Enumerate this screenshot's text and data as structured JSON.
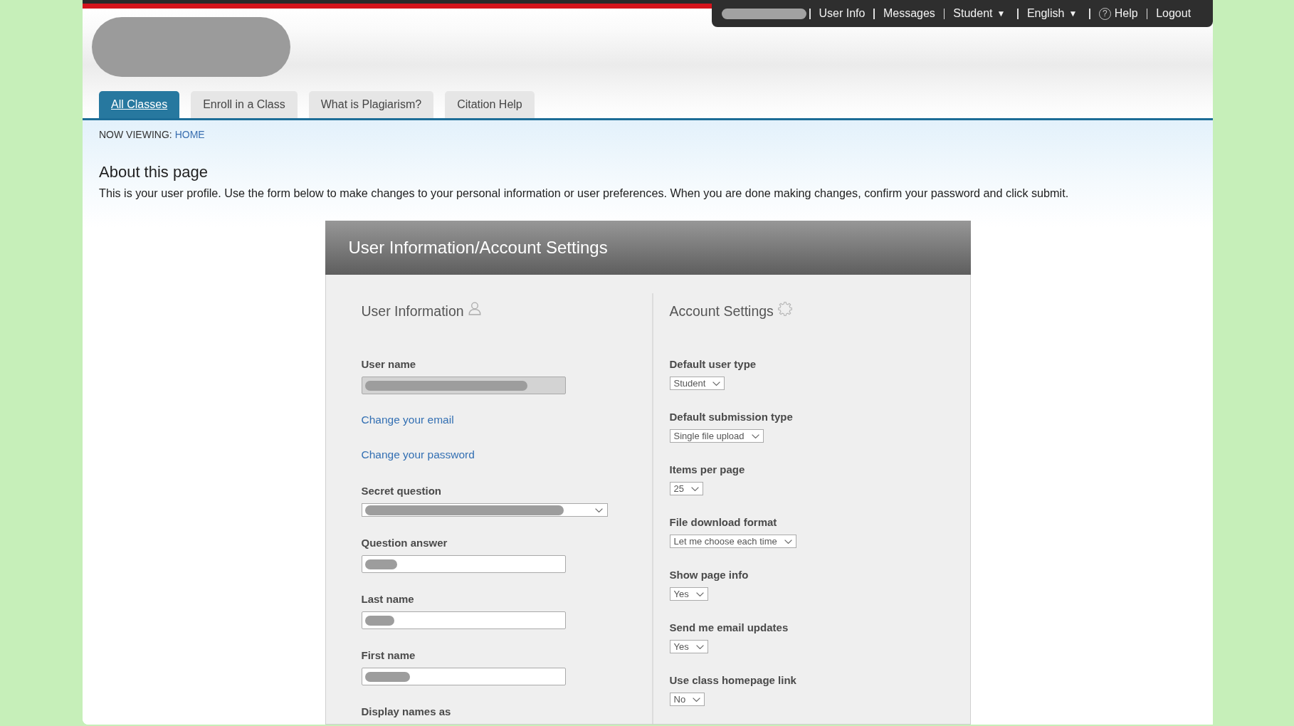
{
  "top_bar": {
    "items": [
      {
        "kind": "link",
        "label": "User Info"
      },
      {
        "kind": "link",
        "label": "Messages"
      },
      {
        "kind": "menu",
        "label": "Student",
        "caret": "▼"
      },
      {
        "kind": "menu",
        "label": "English",
        "caret": "▼"
      },
      {
        "kind": "help",
        "icon": "?",
        "label": "Help"
      },
      {
        "kind": "link",
        "label": "Logout"
      }
    ]
  },
  "tabs": [
    {
      "label": "All Classes",
      "selected": true
    },
    {
      "label": "Enroll in a Class",
      "selected": false
    },
    {
      "label": "What is Plagiarism?",
      "selected": false
    },
    {
      "label": "Citation Help",
      "selected": false
    }
  ],
  "breadcrumb": {
    "label": "NOW VIEWING:",
    "current": "HOME"
  },
  "about": {
    "title": "About this page",
    "text": "This is your user profile. Use the form below to make changes to your personal information or user preferences. When you are done making changes, confirm your password and click submit."
  },
  "settings_card": {
    "title": "User Information/Account Settings",
    "user_information": {
      "heading": "User Information",
      "fields": [
        {
          "kind": "input",
          "label": "User name",
          "disabled": true,
          "redacted": true
        },
        {
          "kind": "link",
          "label": "Change your email"
        },
        {
          "kind": "link",
          "label": "Change your password"
        },
        {
          "kind": "select",
          "label": "Secret question",
          "disabled": false,
          "redacted": true
        },
        {
          "kind": "input",
          "label": "Question answer",
          "disabled": false,
          "redacted": true
        },
        {
          "kind": "input",
          "label": "Last name",
          "disabled": false,
          "redacted": true
        },
        {
          "kind": "input",
          "label": "First name",
          "disabled": false,
          "redacted": true
        },
        {
          "kind": "label",
          "label": "Display names as"
        }
      ]
    },
    "account_settings": {
      "heading": "Account Settings",
      "fields": [
        {
          "label": "Default user type",
          "value": "Student"
        },
        {
          "label": "Default submission type",
          "value": "Single file upload"
        },
        {
          "label": "Items per page",
          "value": "25"
        },
        {
          "label": "File download format",
          "value": "Let me choose each time"
        },
        {
          "label": "Show page info",
          "value": "Yes"
        },
        {
          "label": "Send me email updates",
          "value": "Yes"
        },
        {
          "label": "Use class homepage link",
          "value": "No"
        }
      ]
    }
  }
}
